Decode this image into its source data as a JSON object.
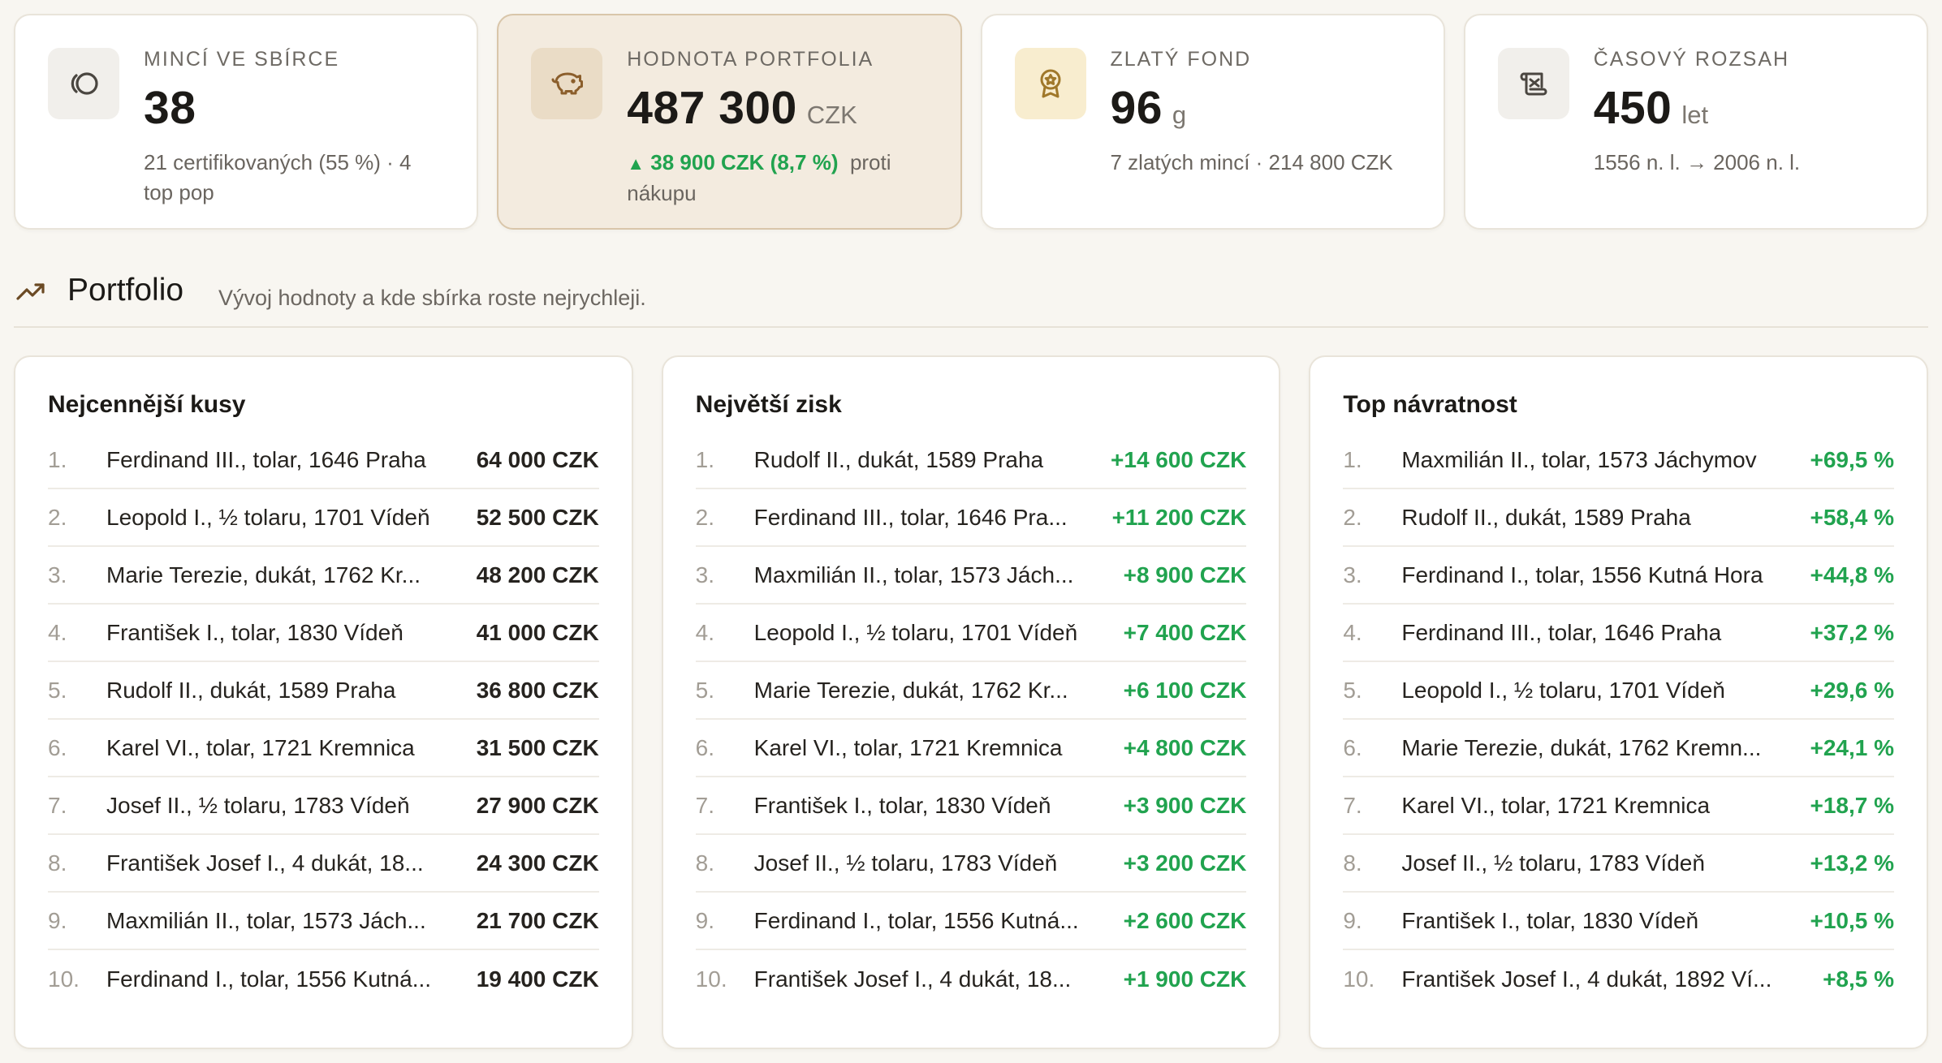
{
  "stats": [
    {
      "label": "MINCÍ VE SBÍRCE",
      "value": "38",
      "unit": "",
      "sub": "21 certifikovaných (55 %) · 4 top pop",
      "icon": "coins-icon"
    },
    {
      "label": "HODNOTA PORTFOLIA",
      "value": "487 300",
      "unit": "CZK",
      "gain": "38 900 CZK (8,7 %)",
      "gain_suffix": "proti nákupu",
      "icon": "piggy-bank-icon"
    },
    {
      "label": "ZLATÝ FOND",
      "value": "96",
      "unit": "g",
      "sub": "7 zlatých mincí · 214 800 CZK",
      "icon": "award-icon"
    },
    {
      "label": "ČASOVÝ ROZSAH",
      "value": "450",
      "unit": "let",
      "sub": "1556 n. l. → 2006 n. l.",
      "icon": "scroll-icon"
    }
  ],
  "section": {
    "title": "Portfolio",
    "description": "Vývoj hodnoty a kde sbírka roste nejrychleji."
  },
  "panels": [
    {
      "title": "Nejcennější kusy",
      "positive": false,
      "rows": [
        {
          "rank": "1.",
          "name": "Ferdinand III., tolar, 1646 Praha",
          "value": "64 000 CZK"
        },
        {
          "rank": "2.",
          "name": "Leopold I., ½ tolaru, 1701 Vídeň",
          "value": "52 500 CZK"
        },
        {
          "rank": "3.",
          "name": "Marie Terezie, dukát, 1762 Kr...",
          "value": "48 200 CZK"
        },
        {
          "rank": "4.",
          "name": "František I., tolar, 1830 Vídeň",
          "value": "41 000 CZK"
        },
        {
          "rank": "5.",
          "name": "Rudolf II., dukát, 1589 Praha",
          "value": "36 800 CZK"
        },
        {
          "rank": "6.",
          "name": "Karel VI., tolar, 1721 Kremnica",
          "value": "31 500 CZK"
        },
        {
          "rank": "7.",
          "name": "Josef II., ½ tolaru, 1783 Vídeň",
          "value": "27 900 CZK"
        },
        {
          "rank": "8.",
          "name": "František Josef I., 4 dukát, 18...",
          "value": "24 300 CZK"
        },
        {
          "rank": "9.",
          "name": "Maxmilián II., tolar, 1573 Jách...",
          "value": "21 700 CZK"
        },
        {
          "rank": "10.",
          "name": "Ferdinand I., tolar, 1556 Kutná...",
          "value": "19 400 CZK"
        }
      ]
    },
    {
      "title": "Největší zisk",
      "positive": true,
      "rows": [
        {
          "rank": "1.",
          "name": "Rudolf II., dukát, 1589 Praha",
          "value": "+14 600 CZK"
        },
        {
          "rank": "2.",
          "name": "Ferdinand III., tolar, 1646 Pra...",
          "value": "+11 200 CZK"
        },
        {
          "rank": "3.",
          "name": "Maxmilián II., tolar, 1573 Jách...",
          "value": "+8 900 CZK"
        },
        {
          "rank": "4.",
          "name": "Leopold I., ½ tolaru, 1701 Vídeň",
          "value": "+7 400 CZK"
        },
        {
          "rank": "5.",
          "name": "Marie Terezie, dukát, 1762 Kr...",
          "value": "+6 100 CZK"
        },
        {
          "rank": "6.",
          "name": "Karel VI., tolar, 1721 Kremnica",
          "value": "+4 800 CZK"
        },
        {
          "rank": "7.",
          "name": "František I., tolar, 1830 Vídeň",
          "value": "+3 900 CZK"
        },
        {
          "rank": "8.",
          "name": "Josef II., ½ tolaru, 1783 Vídeň",
          "value": "+3 200 CZK"
        },
        {
          "rank": "9.",
          "name": "Ferdinand I., tolar, 1556 Kutná...",
          "value": "+2 600 CZK"
        },
        {
          "rank": "10.",
          "name": "František Josef I., 4 dukát, 18...",
          "value": "+1 900 CZK"
        }
      ]
    },
    {
      "title": "Top návratnost",
      "positive": true,
      "rows": [
        {
          "rank": "1.",
          "name": "Maxmilián II., tolar, 1573 Jáchymov",
          "value": "+69,5 %"
        },
        {
          "rank": "2.",
          "name": "Rudolf II., dukát, 1589 Praha",
          "value": "+58,4 %"
        },
        {
          "rank": "3.",
          "name": "Ferdinand I., tolar, 1556 Kutná Hora",
          "value": "+44,8 %"
        },
        {
          "rank": "4.",
          "name": "Ferdinand III., tolar, 1646 Praha",
          "value": "+37,2 %"
        },
        {
          "rank": "5.",
          "name": "Leopold I., ½ tolaru, 1701 Vídeň",
          "value": "+29,6 %"
        },
        {
          "rank": "6.",
          "name": "Marie Terezie, dukát, 1762 Kremn...",
          "value": "+24,1 %"
        },
        {
          "rank": "7.",
          "name": "Karel VI., tolar, 1721 Kremnica",
          "value": "+18,7 %"
        },
        {
          "rank": "8.",
          "name": "Josef II., ½ tolaru, 1783 Vídeň",
          "value": "+13,2 %"
        },
        {
          "rank": "9.",
          "name": "František I., tolar, 1830 Vídeň",
          "value": "+10,5 %"
        },
        {
          "rank": "10.",
          "name": "František Josef I., 4 dukát, 1892 Ví...",
          "value": "+8,5 %"
        }
      ]
    }
  ],
  "colors": {
    "positive": "#21a34f",
    "accent": "#8b5e2b",
    "background": "#f8f6f1"
  }
}
